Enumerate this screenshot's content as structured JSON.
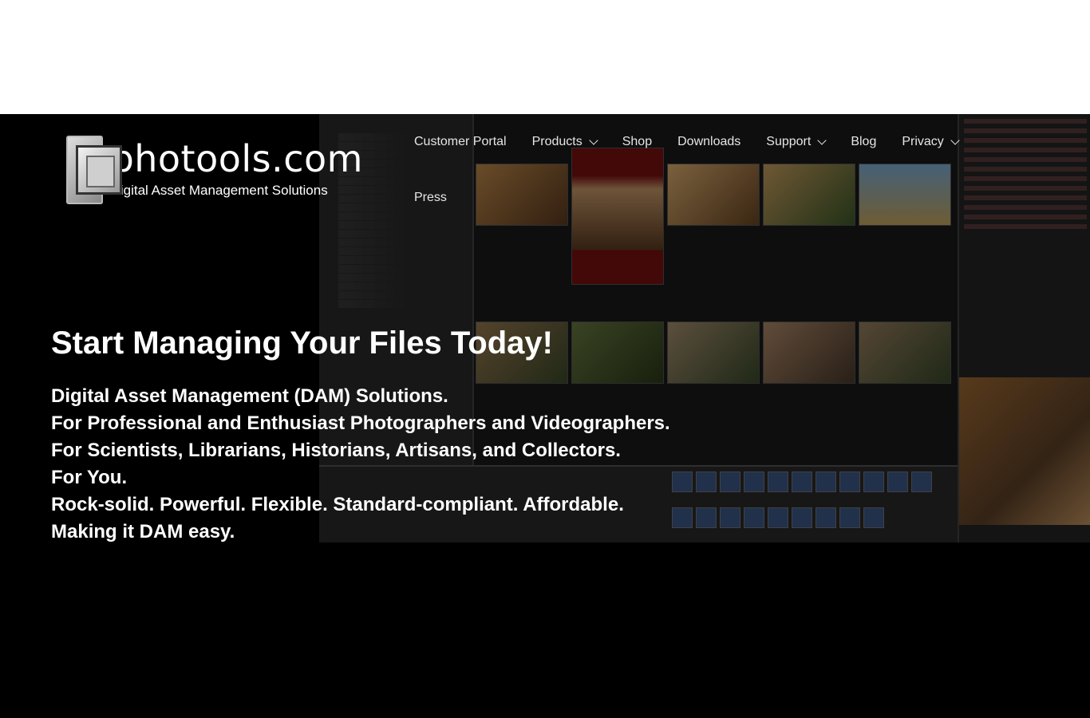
{
  "site": {
    "logo_name": "photools.com",
    "logo_tagline": "Digital Asset Management Solutions"
  },
  "nav": {
    "items": [
      {
        "label": "Customer Portal",
        "has_dropdown": false
      },
      {
        "label": "Products",
        "has_dropdown": true
      },
      {
        "label": "Shop",
        "has_dropdown": false
      },
      {
        "label": "Downloads",
        "has_dropdown": false
      },
      {
        "label": "Support",
        "has_dropdown": true
      },
      {
        "label": "Blog",
        "has_dropdown": false
      },
      {
        "label": "Privacy",
        "has_dropdown": true
      },
      {
        "label": "Press",
        "has_dropdown": false
      }
    ]
  },
  "hero": {
    "headline": "Start Managing Your Files Today!",
    "lines": [
      "Digital Asset Management (DAM) Solutions.",
      "For Professional and Enthusiast Photographers and Videographers.",
      "For Scientists, Librarians, Historians, Artisans, and Collectors.",
      "For You.",
      "Rock-solid. Powerful. Flexible. Standard-compliant. Affordable.",
      "Making it DAM easy."
    ]
  },
  "colors": {
    "background": "#000000",
    "text": "#ffffff",
    "nav_text": "#e6e6e6"
  }
}
